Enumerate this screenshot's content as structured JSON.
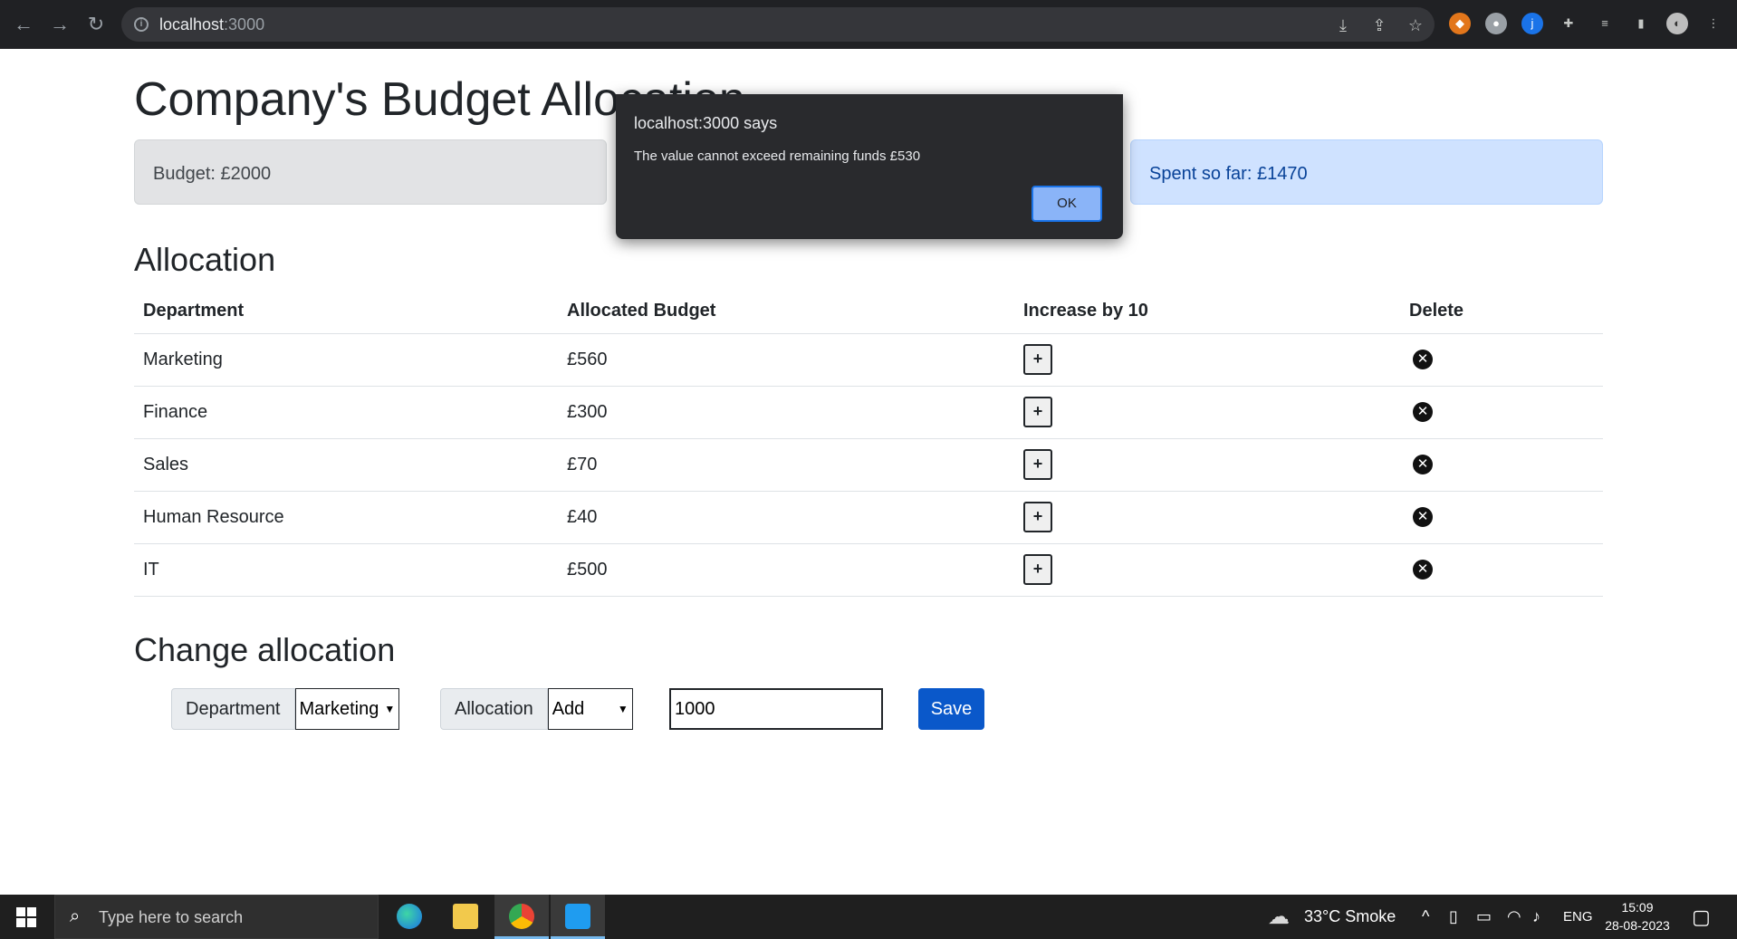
{
  "browser": {
    "url_host": "localhost",
    "url_port": ":3000"
  },
  "page": {
    "title": "Company's Budget Allocation",
    "budget_text": "Budget: £2000",
    "remaining_text": "",
    "spent_text": "Spent so far: £1470"
  },
  "allocation": {
    "heading": "Allocation",
    "columns": [
      "Department",
      "Allocated Budget",
      "Increase by 10",
      "Delete"
    ],
    "rows": [
      {
        "department": "Marketing",
        "budget": "£560"
      },
      {
        "department": "Finance",
        "budget": "£300"
      },
      {
        "department": "Sales",
        "budget": "£70"
      },
      {
        "department": "Human Resource",
        "budget": "£40"
      },
      {
        "department": "IT",
        "budget": "£500"
      }
    ],
    "increase_label": "+"
  },
  "change_allocation": {
    "heading": "Change allocation",
    "department_label": "Department",
    "department_selected": "Marketing",
    "allocation_label": "Allocation",
    "allocation_selected": "Add",
    "amount_value": "1000",
    "save_label": "Save"
  },
  "alert": {
    "origin": "localhost:3000 says",
    "message": "The value cannot exceed remaining funds  £530",
    "ok_label": "OK"
  },
  "taskbar": {
    "search_placeholder": "Type here to search",
    "weather": "33°C  Smoke",
    "language": "ENG",
    "time": "15:09",
    "date": "28-08-2023"
  }
}
